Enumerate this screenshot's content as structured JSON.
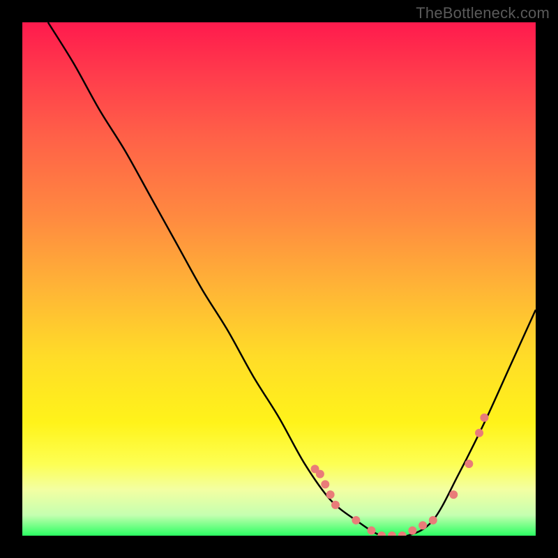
{
  "watermark": "TheBottleneck.com",
  "plot": {
    "coord_width": 736,
    "coord_height": 736,
    "gradient_colors": {
      "top": "#ff1a4d",
      "mid": "#ffdc28",
      "bottom": "#2bff62"
    }
  },
  "chart_data": {
    "type": "line",
    "title": "",
    "xlabel": "",
    "ylabel": "",
    "xlim": [
      0,
      100
    ],
    "ylim": [
      0,
      100
    ],
    "x": [
      5,
      10,
      15,
      20,
      25,
      30,
      35,
      40,
      45,
      50,
      55,
      60,
      65,
      70,
      75,
      80,
      85,
      90,
      95,
      100
    ],
    "y": [
      100,
      92,
      83,
      75,
      66,
      57,
      48,
      40,
      31,
      23,
      14,
      7,
      3,
      0,
      0,
      3,
      12,
      22,
      33,
      44
    ],
    "markers_x": [
      57,
      58,
      59,
      60,
      61,
      65,
      68,
      70,
      72,
      74,
      76,
      78,
      80,
      84,
      87,
      89,
      90
    ],
    "markers_y": [
      13,
      12,
      10,
      8,
      6,
      3,
      1,
      0,
      0,
      0,
      1,
      2,
      3,
      8,
      14,
      20,
      23
    ],
    "note": "x and y are percent coordinates; y=0 is bottom (green), y=100 is top (red). Values estimated from pixel positions; no tick labels present in source image."
  }
}
